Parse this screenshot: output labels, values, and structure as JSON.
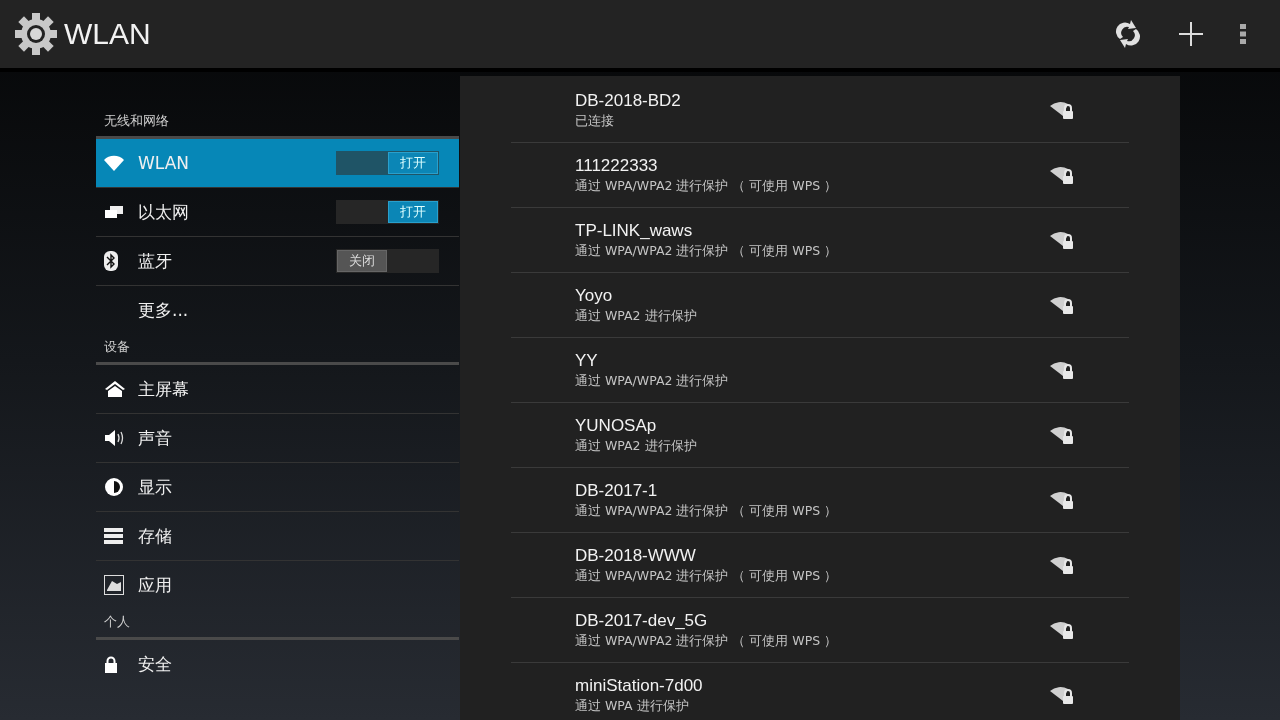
{
  "action_bar": {
    "title": "WLAN"
  },
  "sidebar": {
    "sections": [
      {
        "header": "无线和网络",
        "items": [
          {
            "label": "WLAN",
            "selected": true,
            "switch": {
              "on": true,
              "label": "打开"
            }
          },
          {
            "label": "以太网",
            "selected": false,
            "switch": {
              "on": true,
              "label": "打开"
            }
          },
          {
            "label": "蓝牙",
            "selected": false,
            "switch": {
              "on": false,
              "label": "关闭"
            }
          },
          {
            "label": "更多...",
            "selected": false
          }
        ]
      },
      {
        "header": "设备",
        "items": [
          {
            "label": "主屏幕",
            "selected": false
          },
          {
            "label": "声音",
            "selected": false
          },
          {
            "label": "显示",
            "selected": false
          },
          {
            "label": "存储",
            "selected": false
          },
          {
            "label": "应用",
            "selected": false
          }
        ]
      },
      {
        "header": "个人",
        "items": [
          {
            "label": "安全",
            "selected": false
          }
        ]
      }
    ]
  },
  "networks": [
    {
      "ssid": "DB-2018-BD2",
      "status": "已连接"
    },
    {
      "ssid": "111222333",
      "status": "通过 WPA/WPA2 进行保护 （ 可使用 WPS ）"
    },
    {
      "ssid": "TP-LINK_waws",
      "status": "通过 WPA/WPA2 进行保护 （ 可使用 WPS ）"
    },
    {
      "ssid": "Yoyo",
      "status": "通过 WPA2 进行保护"
    },
    {
      "ssid": "YY",
      "status": "通过 WPA/WPA2 进行保护"
    },
    {
      "ssid": "YUNOSAp",
      "status": "通过 WPA2 进行保护"
    },
    {
      "ssid": "DB-2017-1",
      "status": "通过 WPA/WPA2 进行保护 （ 可使用 WPS ）"
    },
    {
      "ssid": "DB-2018-WWW",
      "status": "通过 WPA/WPA2 进行保护 （ 可使用 WPS ）"
    },
    {
      "ssid": "DB-2017-dev_5G",
      "status": "通过 WPA/WPA2 进行保护 （ 可使用 WPS ）"
    },
    {
      "ssid": "miniStation-7d00",
      "status": "通过 WPA 进行保护"
    }
  ]
}
